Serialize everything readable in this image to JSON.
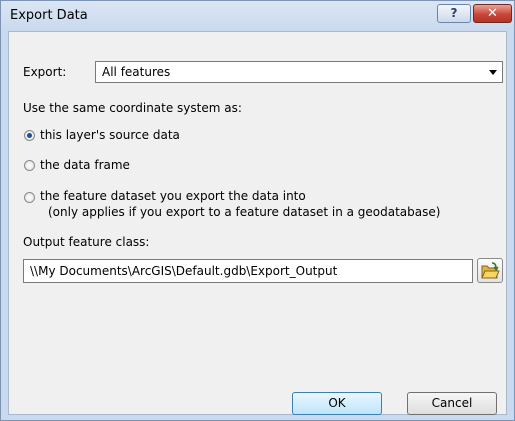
{
  "window": {
    "title": "Export Data",
    "help_label": "?",
    "close_label": "✕"
  },
  "export": {
    "label": "Export:",
    "selected": "All features"
  },
  "coordinate_system": {
    "label": "Use the same coordinate system as:",
    "options": [
      {
        "label": "this layer's source data",
        "selected": true
      },
      {
        "label": "the data frame",
        "selected": false
      },
      {
        "label": "the feature dataset you export the data into",
        "note": "(only applies if you export to a feature dataset in a geodatabase)",
        "selected": false
      }
    ]
  },
  "output": {
    "label": "Output feature class:",
    "value": "\\\\My Documents\\ArcGIS\\Default.gdb\\Export_Output"
  },
  "buttons": {
    "ok": "OK",
    "cancel": "Cancel"
  },
  "icons": {
    "browse": "folder-open-icon"
  }
}
